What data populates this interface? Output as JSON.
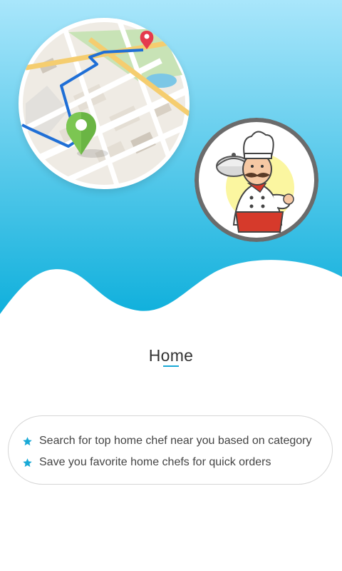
{
  "colors": {
    "sky_top": "#a9e6fb",
    "sky_bottom": "#10b0dc",
    "accent": "#19a9d6",
    "text_dark": "#333333",
    "text_body": "#444444"
  },
  "hero": {
    "map_illustration": "map-route-icon",
    "chef_illustration": "chef-icon"
  },
  "page": {
    "title": "Home"
  },
  "features": {
    "items": [
      {
        "icon": "star-icon",
        "text": "Search for top home chef near you based on category"
      },
      {
        "icon": "star-icon",
        "text": "Save you favorite home chefs for quick orders"
      }
    ]
  }
}
